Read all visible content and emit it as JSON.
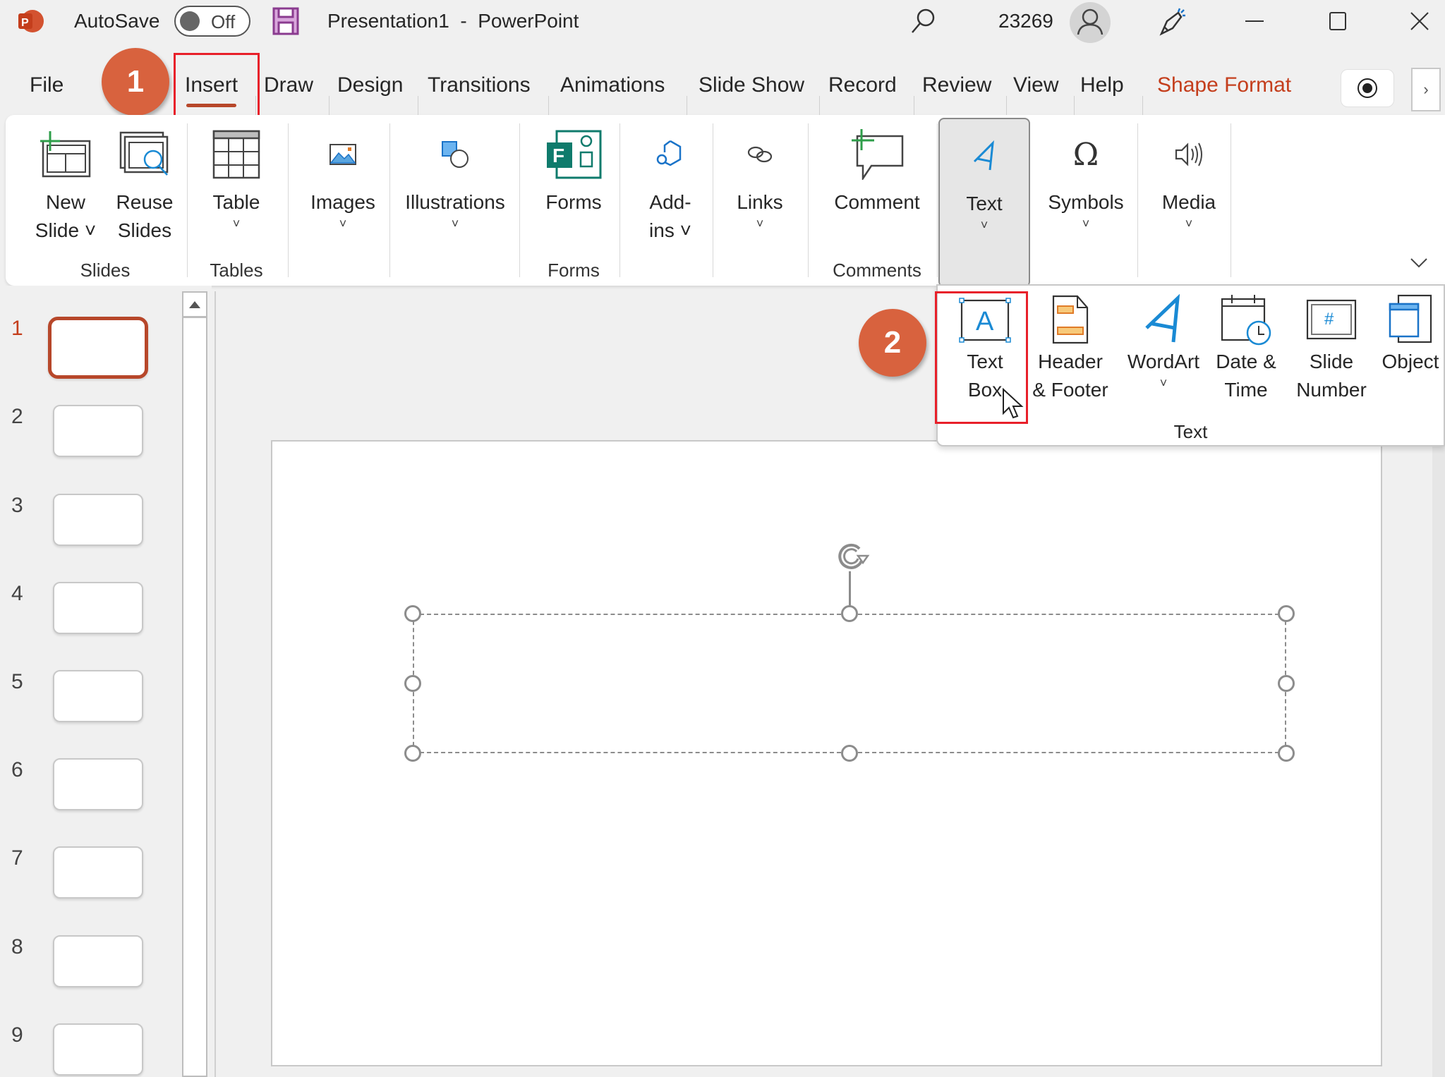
{
  "titlebar": {
    "app_icon": "powerpoint-logo-icon",
    "autosave_label": "AutoSave",
    "autosave_state": "Off",
    "document_title": "Presentation1  -  PowerPoint",
    "search_icon": "search-icon",
    "user_number": "23269",
    "avatar_icon": "user-avatar-icon",
    "designer_icon": "designer-icon",
    "window_controls": [
      "minimize",
      "maximize",
      "close"
    ]
  },
  "tabs": {
    "items": [
      {
        "label": "File"
      },
      {
        "label": "Insert",
        "active": true
      },
      {
        "label": "Draw"
      },
      {
        "label": "Design"
      },
      {
        "label": "Transitions"
      },
      {
        "label": "Animations"
      },
      {
        "label": "Slide Show"
      },
      {
        "label": "Record"
      },
      {
        "label": "Review"
      },
      {
        "label": "View"
      },
      {
        "label": "Help"
      },
      {
        "label": "Shape Format",
        "contextual": true
      }
    ],
    "record_icon": "record-icon",
    "more_icon": "chevron-right-icon"
  },
  "annotations": {
    "step1": "1",
    "step2": "2",
    "highlight_color": "#e8202a",
    "badge_color": "#d8623e"
  },
  "ribbon": {
    "buttons": {
      "new_slide": {
        "line1": "New",
        "line2": "Slide ˅"
      },
      "reuse_slides": {
        "line1": "Reuse",
        "line2": "Slides"
      },
      "table": {
        "label": "Table"
      },
      "images": {
        "label": "Images"
      },
      "illustrations": {
        "label": "Illustrations"
      },
      "forms": {
        "label": "Forms"
      },
      "addins": {
        "line1": "Add-",
        "line2": "ins ˅"
      },
      "links": {
        "label": "Links"
      },
      "comment": {
        "label": "Comment"
      },
      "text": {
        "label": "Text"
      },
      "symbols": {
        "label": "Symbols"
      },
      "media": {
        "label": "Media"
      }
    },
    "groups": {
      "slides": "Slides",
      "tables": "Tables",
      "forms": "Forms",
      "comments": "Comments"
    },
    "chevron": "˅",
    "collapse_icon": "⌄"
  },
  "text_dropdown": {
    "group_label": "Text",
    "buttons": [
      {
        "line1": "Text",
        "line2": "Box"
      },
      {
        "line1": "Header",
        "line2": "& Footer"
      },
      {
        "line1": "WordArt",
        "line2": "˅"
      },
      {
        "line1": "Date &",
        "line2": "Time"
      },
      {
        "line1": "Slide",
        "line2": "Number"
      },
      {
        "line1": "Object",
        "line2": ""
      }
    ]
  },
  "slide_panel": {
    "slides": [
      "1",
      "2",
      "3",
      "4",
      "5",
      "6",
      "7",
      "8",
      "9"
    ],
    "active_slide": "1"
  }
}
